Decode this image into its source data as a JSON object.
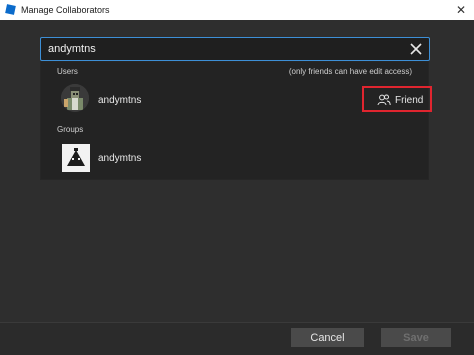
{
  "window": {
    "title": "Manage Collaborators"
  },
  "search": {
    "value": "andymtns",
    "placeholder": ""
  },
  "results": {
    "users_heading": "Users",
    "note": "(only friends can have edit access)",
    "user": {
      "name": "andymtns",
      "action_label": "Friend"
    },
    "groups_heading": "Groups",
    "group": {
      "name": "andymtns"
    }
  },
  "footer": {
    "cancel_label": "Cancel",
    "save_label": "Save"
  },
  "colors": {
    "accent": "#3d8fd6",
    "highlight": "#e0252f",
    "panel": "#232323",
    "background": "#2e2e2e"
  }
}
